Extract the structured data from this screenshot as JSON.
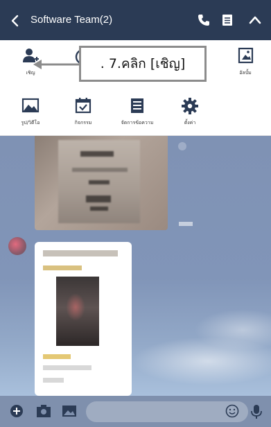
{
  "header": {
    "title": "Software Team(2)",
    "icons": [
      "back-icon",
      "phone-icon",
      "notes-icon",
      "collapse-icon"
    ]
  },
  "menu": {
    "items": [
      {
        "label": "เชิญ",
        "icon": "invite-icon"
      },
      {
        "label": "อัลบั้ม",
        "icon": "album-icon"
      },
      {
        "label": "รูป/วิดีโอ",
        "icon": "photo-video-icon"
      },
      {
        "label": "กิจกรรม",
        "icon": "event-icon"
      },
      {
        "label": "จัดการข้อความ",
        "icon": "notes-list-icon"
      },
      {
        "label": "ตั้งค่า",
        "icon": "settings-icon"
      }
    ]
  },
  "callout": {
    "text": ". 7.คลิก [เชิญ]"
  },
  "colors": {
    "header_bg": "#2b3b55",
    "chat_bg": "#8195b8",
    "callout_border": "#8c8c8c"
  },
  "bottom_bar": {
    "icons": [
      "add-icon",
      "camera-icon",
      "image-icon",
      "emoji-icon",
      "mic-icon"
    ]
  }
}
